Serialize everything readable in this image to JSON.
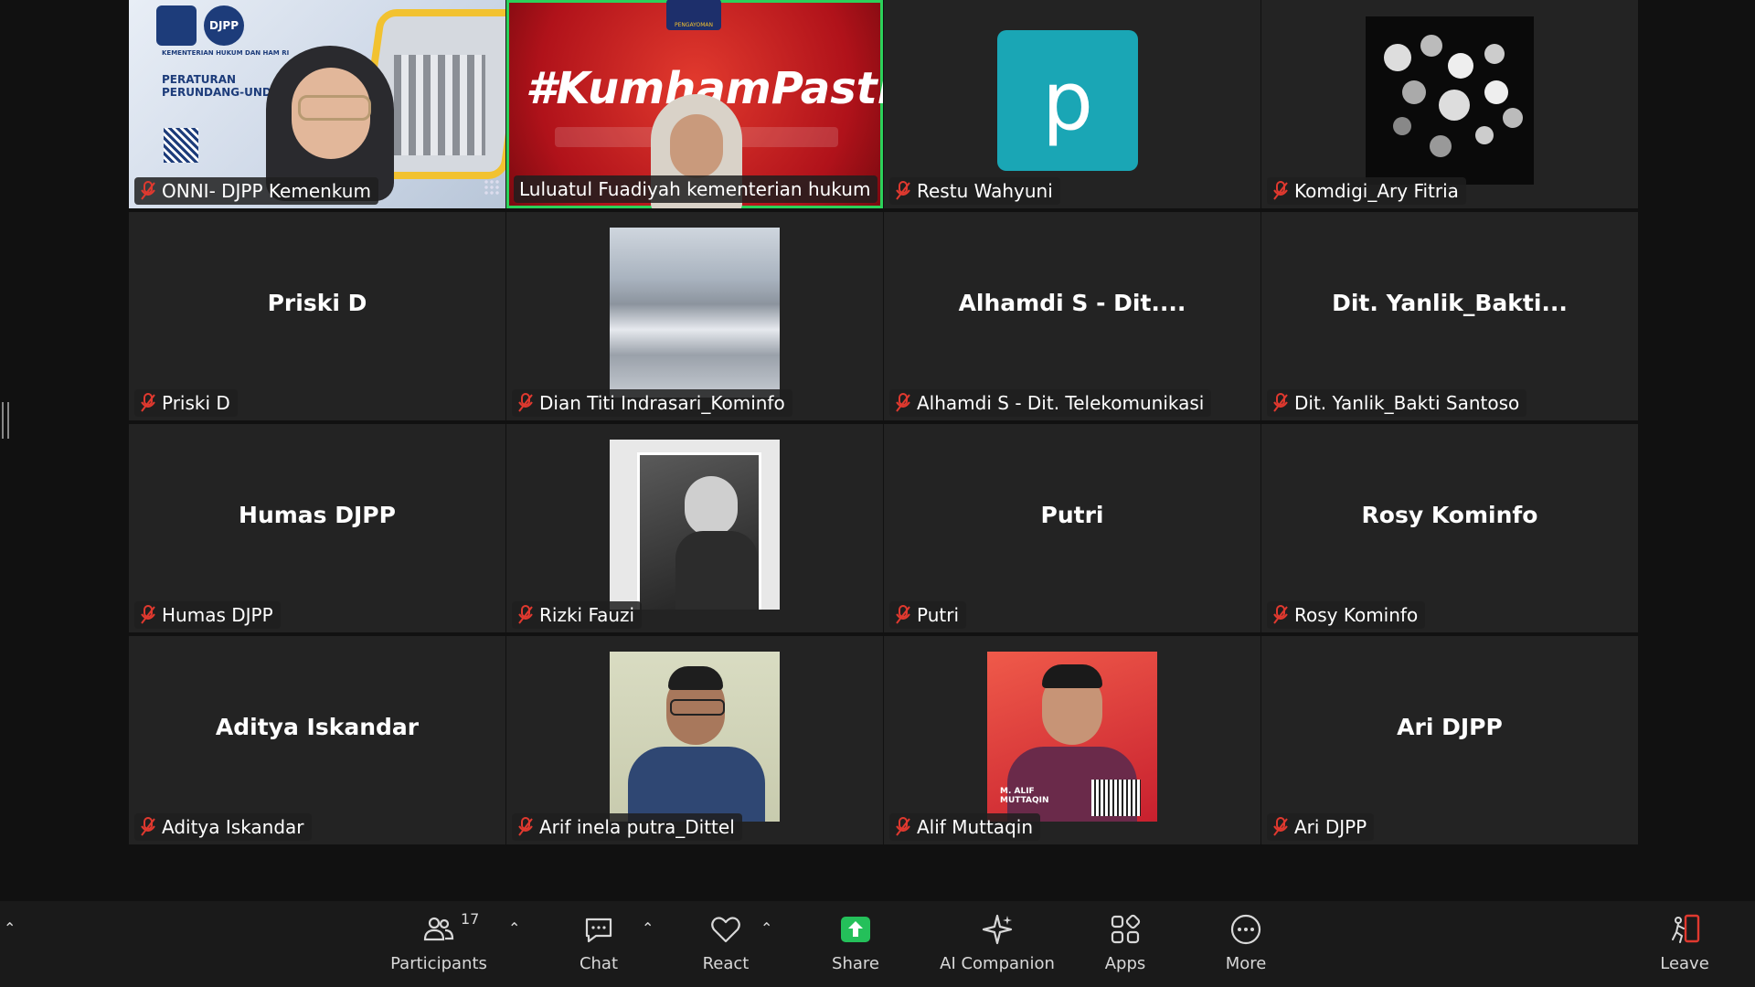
{
  "participants": [
    {
      "display_name": "ONNI- DJPP Kemenkum",
      "center_label": "",
      "video": "slide-djpp"
    },
    {
      "display_name": "Luluatul Fuadiyah kementerian hukum",
      "center_label": "",
      "video": "kumham-red",
      "active": true,
      "banner_text": "#KumhamPasti",
      "logo_text": "PENGAYOMAN"
    },
    {
      "display_name": "Restu Wahyuni",
      "center_label": "",
      "video": "avatar-letter",
      "avatar_letter": "p"
    },
    {
      "display_name": "Komdigi_Ary Fitria",
      "center_label": "",
      "video": "bokeh"
    },
    {
      "display_name": "Priski D",
      "center_label": "Priski D",
      "video": "none"
    },
    {
      "display_name": "Dian Titi Indrasari_Kominfo",
      "center_label": "",
      "video": "mountains"
    },
    {
      "display_name": "Alhamdi S - Dit. Telekomunikasi",
      "center_label": "Alhamdi S - Dit....",
      "video": "none"
    },
    {
      "display_name": "Dit. Yanlik_Bakti Santoso",
      "center_label": "Dit.  Yanlik_Bakti...",
      "video": "none"
    },
    {
      "display_name": "Humas DJPP",
      "center_label": "Humas DJPP",
      "video": "none"
    },
    {
      "display_name": "Rizki Fauzi",
      "center_label": "",
      "video": "bw-photo"
    },
    {
      "display_name": "Putri",
      "center_label": "Putri",
      "video": "none"
    },
    {
      "display_name": "Rosy Kominfo",
      "center_label": "Rosy Kominfo",
      "video": "none"
    },
    {
      "display_name": "Aditya Iskandar",
      "center_label": "Aditya Iskandar",
      "video": "none"
    },
    {
      "display_name": "Arif inela putra_Dittel",
      "center_label": "",
      "video": "portrait-glasses"
    },
    {
      "display_name": "Alif Muttaqin",
      "center_label": "",
      "video": "portrait-red",
      "card_text": "M. ALIF MUTTAQIN"
    },
    {
      "display_name": "Ari DJPP",
      "center_label": "Ari DJPP",
      "video": "none"
    }
  ],
  "slide": {
    "org_line": "KEMENTERIAN HUKUM DAN HAM RI",
    "title_line1": "PERATURAN",
    "title_line2": "PERUNDANG-UNDANG",
    "badge": "DJPP"
  },
  "toolbar": {
    "participants_label": "Participants",
    "participants_count": "17",
    "chat_label": "Chat",
    "react_label": "React",
    "share_label": "Share",
    "ai_label": "AI Companion",
    "apps_label": "Apps",
    "more_label": "More",
    "leave_label": "Leave"
  },
  "colors": {
    "tile_bg": "#232323",
    "active_border": "#2bd15a",
    "mic_muted": "#e0392f",
    "share_green": "#24c05a",
    "leave_red": "#e0392f",
    "avatar_teal": "#1aa6b5"
  }
}
